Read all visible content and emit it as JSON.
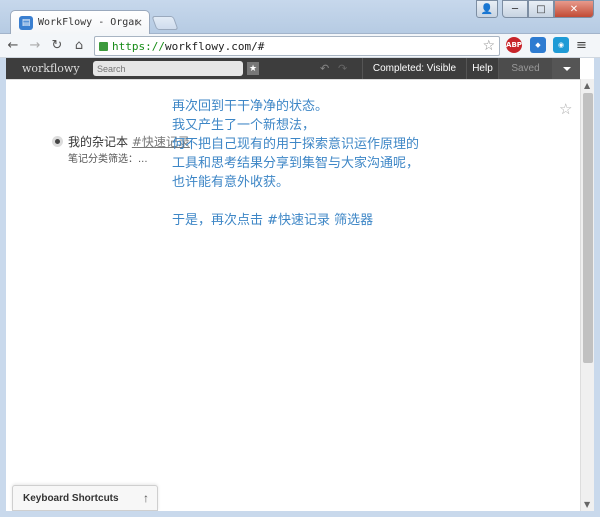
{
  "browser": {
    "tab_title": "WorkFlowy - Organize yo",
    "tab_close": "×",
    "url_scheme": "https://",
    "url_rest": "workflowy.com/#",
    "ext_abp": "ABP",
    "window_user": "👤",
    "window_min": "─",
    "window_max": "□",
    "window_close": "✕"
  },
  "app": {
    "brand": "workflowy",
    "search_placeholder": "Search",
    "completed_label": "Completed: Visible",
    "help_label": "Help",
    "saved_label": "Saved"
  },
  "content": {
    "item_title": "我的杂记本",
    "item_tag": "#快速记录",
    "item_note": "笔记分类筛选：...",
    "annotation_lines": [
      "再次回到干干净净的状态。",
      "我又产生了一个新想法，",
      "何不把自己现有的用于探索意识运作原理的",
      "工具和思考结果分享到集智与大家沟通呢，",
      "也许能有意外收获。",
      "",
      "于是，再次点击 #快速记录 筛选器"
    ]
  },
  "footer": {
    "keyboard_shortcuts": "Keyboard Shortcuts",
    "arrow": "↑"
  },
  "colors": {
    "annotation": "#3d86c6",
    "appbar": "#3d3d3d"
  }
}
